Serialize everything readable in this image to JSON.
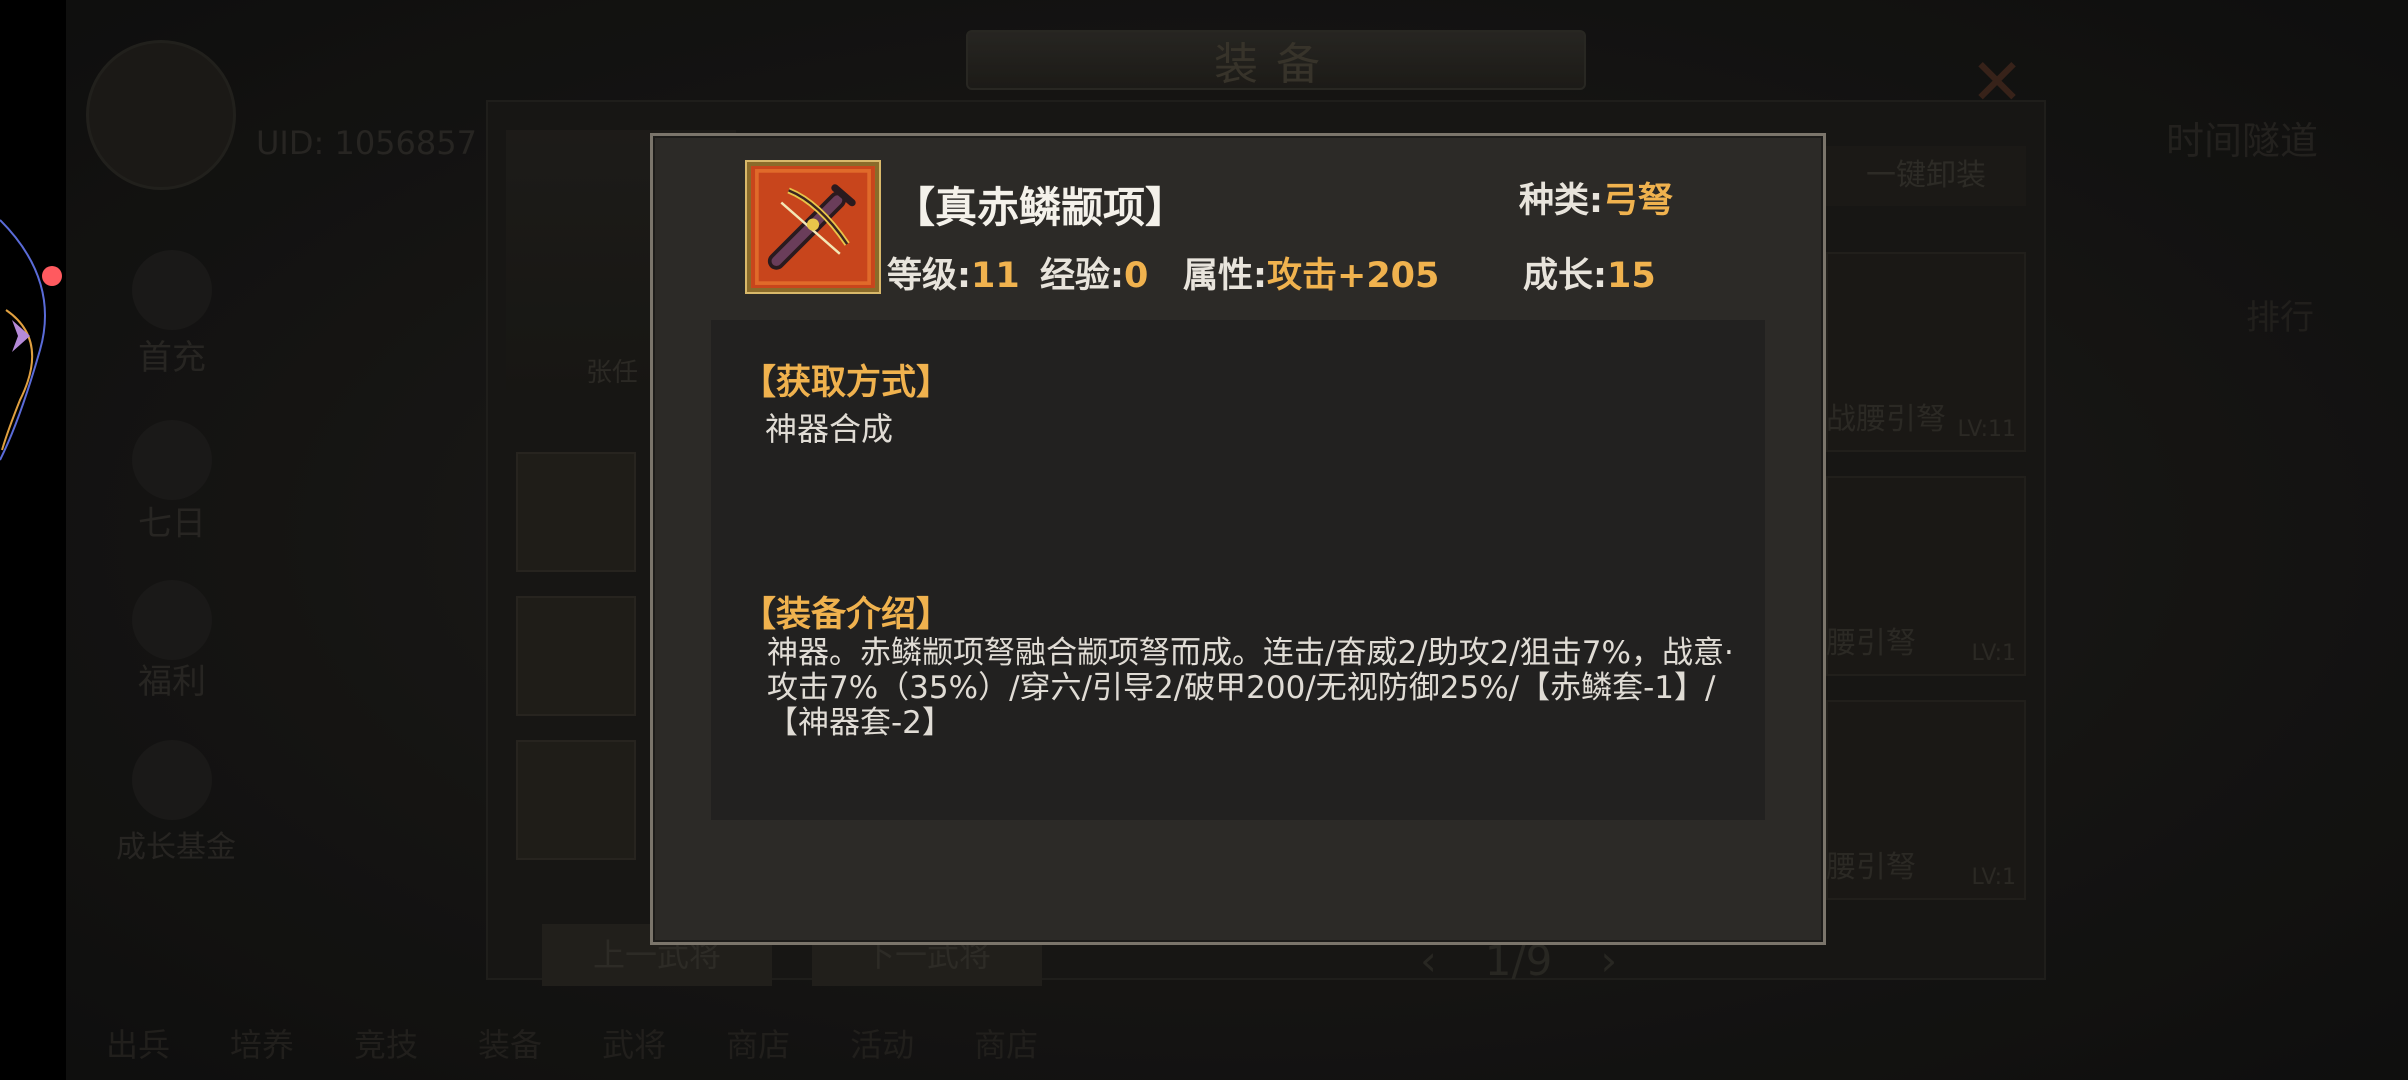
{
  "background": {
    "title": "装备",
    "uid_text": "UID: 1056857",
    "sidebar_items": [
      "首充",
      "七日",
      "福利",
      "成长基金"
    ],
    "hero_name": "张任",
    "unequip_label": "一键卸装",
    "right_label": "时间隧道",
    "right_label_2": "排行",
    "equip_items": [
      {
        "level": "LV:11",
        "name": "战腰引弩"
      },
      {
        "level": "LV:1",
        "name": "腰引弩"
      },
      {
        "level": "LV:1",
        "name": "腰引弩"
      }
    ],
    "prev_button": "上一武将",
    "next_button": "下一武将",
    "pager": {
      "prev": "‹",
      "text": "1/9",
      "next": "›"
    },
    "bottom_nav": [
      "出兵",
      "培养",
      "竞技",
      "装备",
      "武将",
      "商店",
      "活动",
      "商店"
    ]
  },
  "item": {
    "name": "【真赤鳞颛项】",
    "icon": "crossbow-icon",
    "type_label": "种类:",
    "type_value": "弓弩",
    "level_label": "等级:",
    "level_value": "11",
    "exp_label": "经验:",
    "exp_value": "0",
    "attr_label": "属性:",
    "attr_value": "攻击+205",
    "growth_label": "成长:",
    "growth_value": "15"
  },
  "acquire": {
    "title": "【获取方式】",
    "body": "神器合成"
  },
  "intro": {
    "title": "【装备介绍】",
    "body": "神器。赤鳞颛项弩融合颛项弩而成。连击/奋威2/助攻2/狙击7%，战意·攻击7%（35%）/穿六/引导2/破甲200/无视防御25%/【赤鳞套-1】/【神器套-2】"
  },
  "colors": {
    "accent": "#f0b24e",
    "modal_bg": "#2c2a27",
    "modal_border": "#7b756b",
    "info_bg": "#222120",
    "float_dot": "#ff5a5f"
  }
}
